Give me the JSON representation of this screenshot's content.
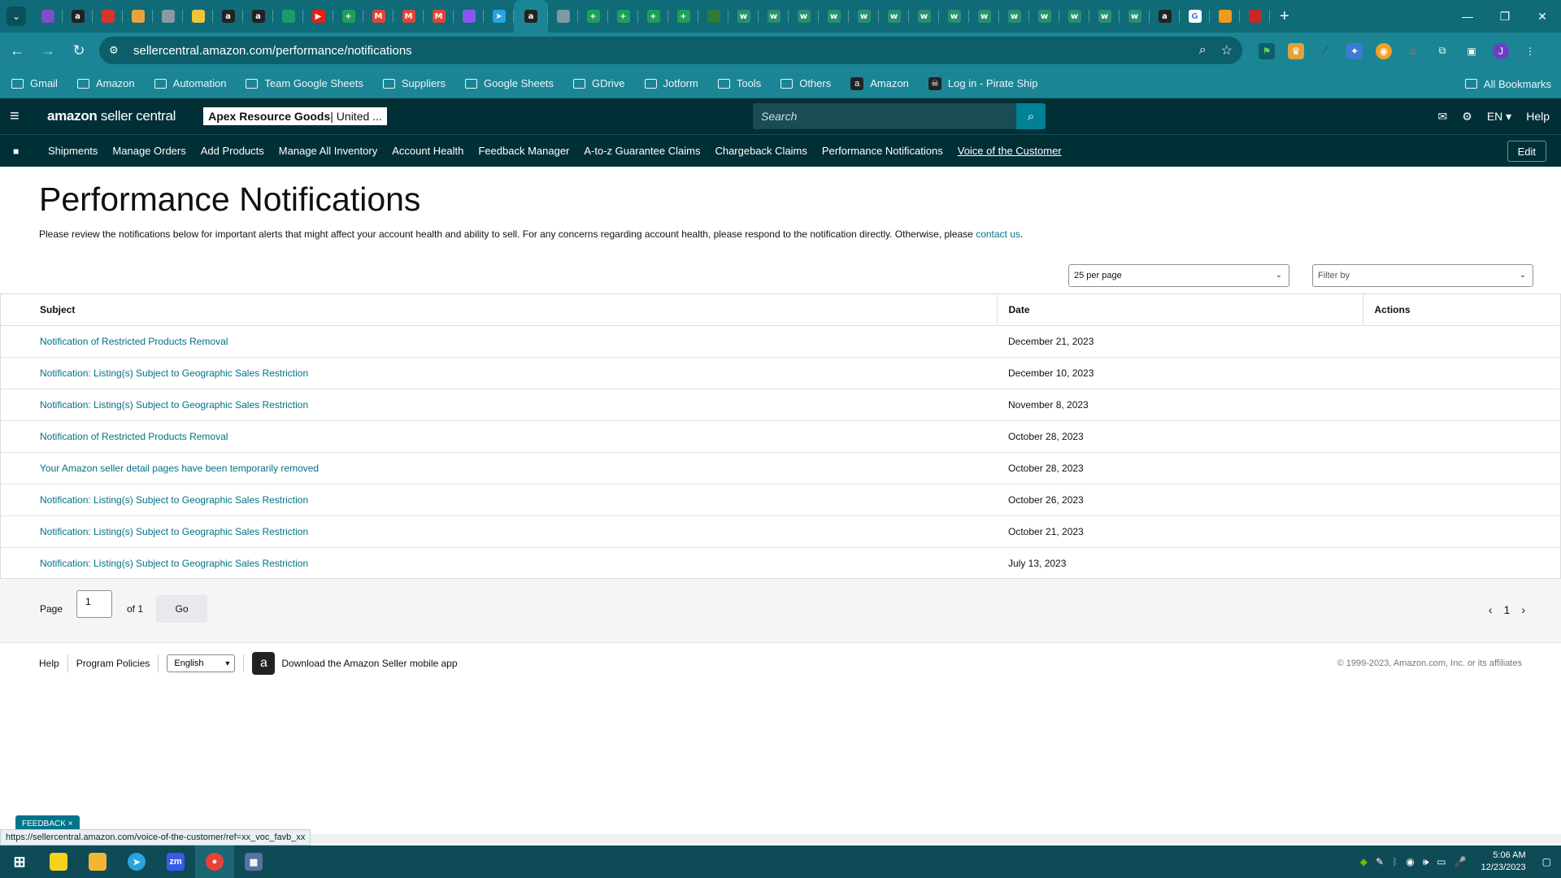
{
  "browser": {
    "url": "sellercentral.amazon.com/performance/notifications",
    "status_url": "https://sellercentral.amazon.com/voice-of-the-customer/ref=xx_voc_favb_xx",
    "tab_favicons": [
      "purple",
      "amazon",
      "red",
      "multicolor",
      "gray",
      "yellow",
      "amazon",
      "amazon",
      "green-circle",
      "youtube",
      "sheets",
      "gmail",
      "gmail",
      "gmail",
      "messenger",
      "telegram",
      "amazon-active",
      "gray-ink",
      "sheets",
      "sheets",
      "sheets",
      "sheets",
      "green-globe",
      "w",
      "w",
      "w",
      "w",
      "w",
      "w",
      "w",
      "w",
      "w",
      "w",
      "w",
      "w",
      "w",
      "w",
      "amazon",
      "google",
      "paint",
      "red-flag"
    ],
    "bookmarks": [
      {
        "label": "Gmail",
        "icon": "folder-icon"
      },
      {
        "label": "Amazon",
        "icon": "folder-icon"
      },
      {
        "label": "Automation",
        "icon": "folder-icon"
      },
      {
        "label": "Team Google Sheets",
        "icon": "folder-icon"
      },
      {
        "label": "Suppliers",
        "icon": "folder-icon"
      },
      {
        "label": "Google Sheets",
        "icon": "folder-icon"
      },
      {
        "label": "GDrive",
        "icon": "folder-icon"
      },
      {
        "label": "Jotform",
        "icon": "folder-icon"
      },
      {
        "label": "Tools",
        "icon": "folder-icon"
      },
      {
        "label": "Others",
        "icon": "folder-icon"
      },
      {
        "label": "Amazon",
        "icon": "amazon-icon"
      },
      {
        "label": "Log in - Pirate Ship",
        "icon": "pirate-icon"
      }
    ],
    "all_bookmarks": "All Bookmarks",
    "profile_initial": "J"
  },
  "header": {
    "logo_bold": "amazon",
    "logo_rest": " seller central",
    "store_name": "Apex Resource Goods",
    "store_region": " | United ...",
    "search_placeholder": "Search",
    "lang": "EN",
    "help": "Help"
  },
  "nav": {
    "items": [
      "Shipments",
      "Manage Orders",
      "Add Products",
      "Manage All Inventory",
      "Account Health",
      "Feedback Manager",
      "A-to-z Guarantee Claims",
      "Chargeback Claims",
      "Performance Notifications",
      "Voice of the Customer"
    ],
    "edit": "Edit"
  },
  "page": {
    "title": "Performance Notifications",
    "description": "Please review the notifications below for important alerts that might affect your account health and ability to sell. For any concerns regarding account health, please respond to the notification directly. Otherwise, please ",
    "contact_link": "contact us",
    "description_end": ".",
    "per_page": "25 per page",
    "filter_by": "Filter by"
  },
  "table": {
    "headers": {
      "subject": "Subject",
      "date": "Date",
      "actions": "Actions"
    },
    "rows": [
      {
        "subject": "Notification of Restricted Products Removal",
        "date": "December 21, 2023"
      },
      {
        "subject": "Notification: Listing(s) Subject to Geographic Sales Restriction",
        "date": "December 10, 2023"
      },
      {
        "subject": "Notification: Listing(s) Subject to Geographic Sales Restriction",
        "date": "November 8, 2023"
      },
      {
        "subject": "Notification of Restricted Products Removal",
        "date": "October 28, 2023"
      },
      {
        "subject": "Your Amazon seller detail pages have been temporarily removed",
        "date": "October 28, 2023"
      },
      {
        "subject": "Notification: Listing(s) Subject to Geographic Sales Restriction",
        "date": "October 26, 2023"
      },
      {
        "subject": "Notification: Listing(s) Subject to Geographic Sales Restriction",
        "date": "October 21, 2023"
      },
      {
        "subject": "Notification: Listing(s) Subject to Geographic Sales Restriction",
        "date": "July 13, 2023"
      }
    ]
  },
  "pager": {
    "page_label": "Page",
    "page_value": "1",
    "of_label": "of 1",
    "go": "Go",
    "current": "1"
  },
  "footer": {
    "help": "Help",
    "policies": "Program Policies",
    "language": "English",
    "app": "Download the Amazon Seller mobile app",
    "copyright": "© 1999-2023, Amazon.com, Inc. or its affiliates"
  },
  "feedback": "FEEDBACK",
  "taskbar": {
    "time": "5:06 AM",
    "date": "12/23/2023"
  }
}
